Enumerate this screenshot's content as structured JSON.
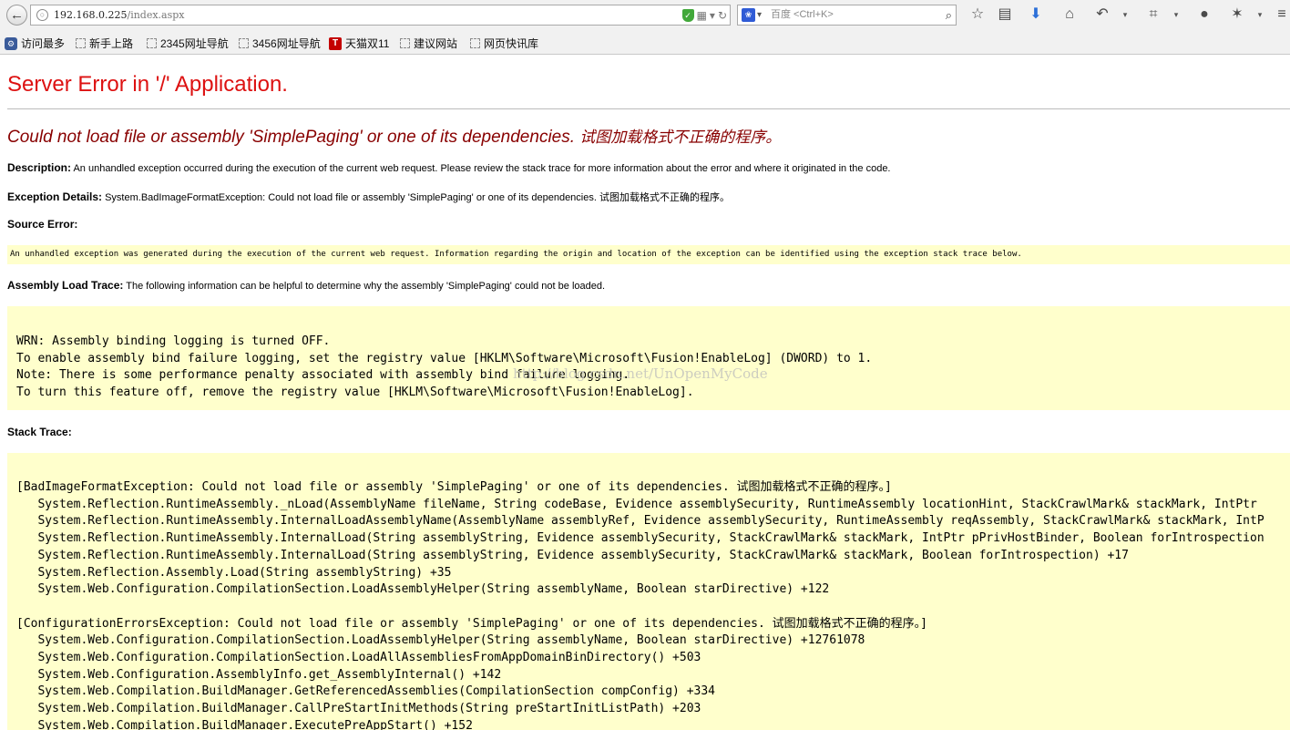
{
  "browser": {
    "url_host": "192.168.0.225",
    "url_path": "/index.aspx",
    "search_placeholder": "百度 <Ctrl+K>",
    "bookmarks": [
      "访问最多",
      "新手上路",
      "2345网址导航",
      "3456网址导航",
      "天猫双11",
      "建议网站",
      "网页快讯库"
    ]
  },
  "page": {
    "title": "Server Error in '/' Application.",
    "error_heading": "Could not load file or assembly 'SimplePaging' or one of its dependencies.",
    "error_heading_cn": "试图加载格式不正确的程序。",
    "description_label": "Description:",
    "description_text": "An unhandled exception occurred during the execution of the current web request. Please review the stack trace for more information about the error and where it originated in the code.",
    "exception_label": "Exception Details:",
    "exception_text": "System.BadImageFormatException: Could not load file or assembly 'SimplePaging' or one of its dependencies. 试图加载格式不正确的程序。",
    "source_label": "Source Error:",
    "source_text": "An unhandled exception was generated during the execution of the current web request. Information regarding the origin and location of the exception can be identified using the exception stack trace below.",
    "assembly_label": "Assembly Load Trace:",
    "assembly_text": "The following information can be helpful to determine why the assembly 'SimplePaging' could not be loaded.",
    "assembly_trace": "WRN: Assembly binding logging is turned OFF.\nTo enable assembly bind failure logging, set the registry value [HKLM\\Software\\Microsoft\\Fusion!EnableLog] (DWORD) to 1.\nNote: There is some performance penalty associated with assembly bind failure logging.\nTo turn this feature off, remove the registry value [HKLM\\Software\\Microsoft\\Fusion!EnableLog].",
    "watermark": "http://blog.csdn.net/UnOpenMyCode",
    "stack_label": "Stack Trace:",
    "stack_trace": "[BadImageFormatException: Could not load file or assembly 'SimplePaging' or one of its dependencies. 试图加载格式不正确的程序。]\n   System.Reflection.RuntimeAssembly._nLoad(AssemblyName fileName, String codeBase, Evidence assemblySecurity, RuntimeAssembly locationHint, StackCrawlMark& stackMark, IntPtr\n   System.Reflection.RuntimeAssembly.InternalLoadAssemblyName(AssemblyName assemblyRef, Evidence assemblySecurity, RuntimeAssembly reqAssembly, StackCrawlMark& stackMark, IntP\n   System.Reflection.RuntimeAssembly.InternalLoad(String assemblyString, Evidence assemblySecurity, StackCrawlMark& stackMark, IntPtr pPrivHostBinder, Boolean forIntrospection\n   System.Reflection.RuntimeAssembly.InternalLoad(String assemblyString, Evidence assemblySecurity, StackCrawlMark& stackMark, Boolean forIntrospection) +17\n   System.Reflection.Assembly.Load(String assemblyString) +35\n   System.Web.Configuration.CompilationSection.LoadAssemblyHelper(String assemblyName, Boolean starDirective) +122\n\n[ConfigurationErrorsException: Could not load file or assembly 'SimplePaging' or one of its dependencies. 试图加载格式不正确的程序。]\n   System.Web.Configuration.CompilationSection.LoadAssemblyHelper(String assemblyName, Boolean starDirective) +12761078\n   System.Web.Configuration.CompilationSection.LoadAllAssembliesFromAppDomainBinDirectory() +503\n   System.Web.Configuration.AssemblyInfo.get_AssemblyInternal() +142\n   System.Web.Compilation.BuildManager.GetReferencedAssemblies(CompilationSection compConfig) +334\n   System.Web.Compilation.BuildManager.CallPreStartInitMethods(String preStartInitListPath) +203\n   System.Web.Compilation.BuildManager.ExecutePreAppStart() +152"
  }
}
